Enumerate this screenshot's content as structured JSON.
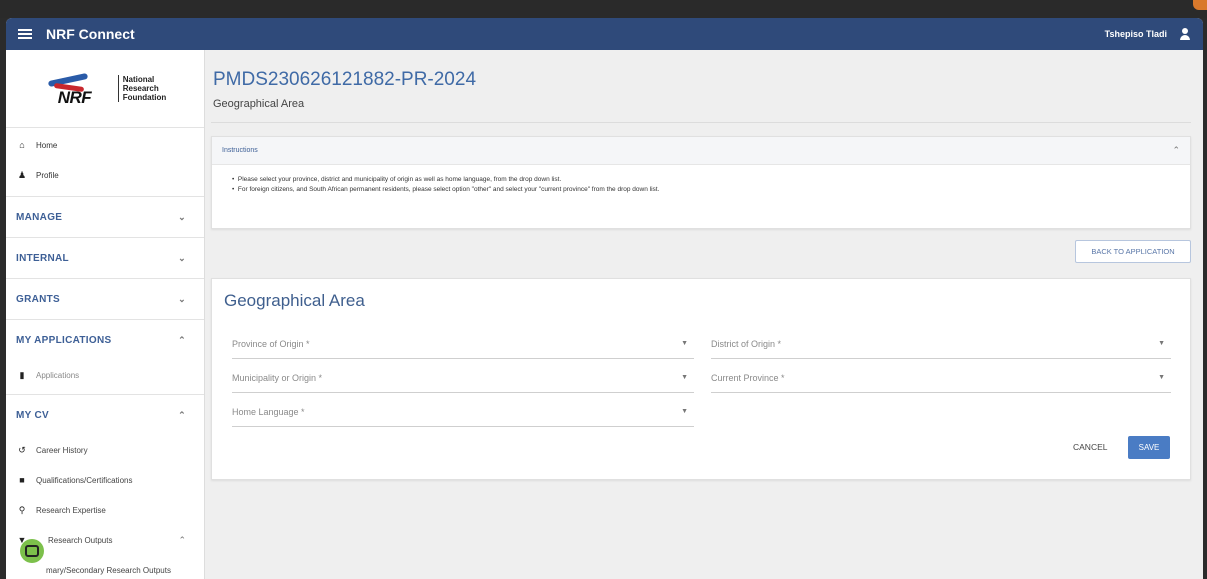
{
  "app": {
    "title": "NRF Connect",
    "user_name": "Tshepiso Tladi"
  },
  "logo": {
    "line1": "National",
    "line2": "Research",
    "line3": "Foundation",
    "mark": "NRF"
  },
  "sidebar": {
    "top_items": [
      {
        "label": "Home",
        "icon": "home-icon"
      },
      {
        "label": "Profile",
        "icon": "user-icon"
      }
    ],
    "sections": {
      "manage": "MANAGE",
      "internal": "INTERNAL",
      "grants": "GRANTS",
      "my_applications": "MY APPLICATIONS",
      "my_cv": "MY CV"
    },
    "applications_item": "Applications",
    "cv_items": [
      {
        "label": "Career History",
        "icon": "history-icon"
      },
      {
        "label": "Qualifications/Certifications",
        "icon": "graduation-icon"
      },
      {
        "label": "Research Expertise",
        "icon": "search-icon"
      },
      {
        "label": "Research Outputs",
        "icon": "caret-down-icon"
      },
      {
        "label": "mary/Secondary Research Outputs",
        "icon": ""
      }
    ]
  },
  "main": {
    "reference": "PMDS230626121882-PR-2024",
    "subtitle": "Geographical Area",
    "instructions": {
      "title": "Instructions",
      "lines": [
        "Please select your province, district and municipality of origin as well as home language, from the drop down list.",
        "For foreign citizens, and South African permanent residents,  please select option \"other\" and select your \"current province\" from the drop down list."
      ]
    },
    "back_button": "BACK TO APPLICATION",
    "form": {
      "title": "Geographical Area",
      "fields": {
        "province": "Province of Origin *",
        "district": "District of Origin *",
        "municipality": "Municipality or Origin *",
        "current_province": "Current Province *",
        "home_language": "Home Language *"
      },
      "cancel": "CANCEL",
      "save": "SAVE"
    }
  },
  "colors": {
    "appbar": "#2f4a7a",
    "accent": "#3f6aa6",
    "save": "#4a7cc4",
    "chat": "#7cc04b"
  }
}
